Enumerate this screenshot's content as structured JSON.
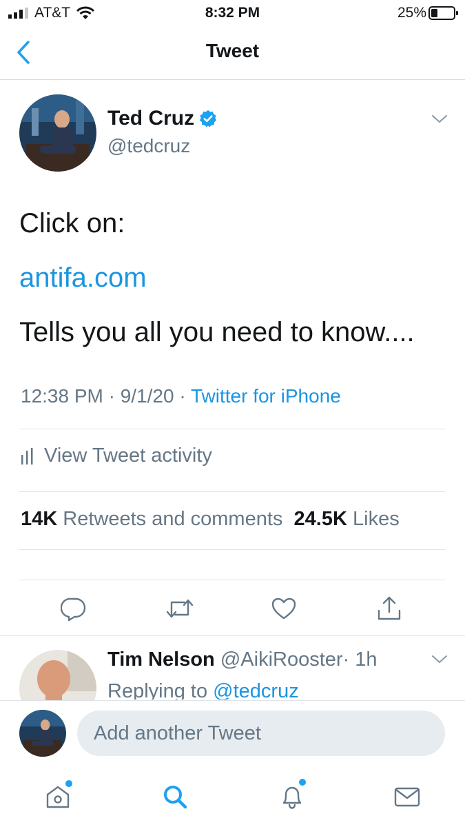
{
  "status_bar": {
    "carrier": "AT&T",
    "time": "8:32 PM",
    "battery": "25%"
  },
  "nav": {
    "title": "Tweet"
  },
  "tweet": {
    "author_name": "Ted Cruz",
    "author_handle": "@tedcruz",
    "text_line1": "Click on:",
    "link": "antifa.com",
    "text_line2": "Tells you all you need to know....",
    "timestamp": "12:38 PM · 9/1/20 · ",
    "source": "Twitter for iPhone",
    "activity_label": "View Tweet activity",
    "retweets_count": "14K",
    "retweets_label": "Retweets and comments",
    "likes_count": "24.5K",
    "likes_label": "Likes"
  },
  "reply": {
    "author_name": "Tim Nelson",
    "author_handle": "@AikiRooster",
    "time_ago": "· 1h",
    "replying_prefix": "Replying to ",
    "replying_handle": "@tedcruz"
  },
  "composer": {
    "placeholder": "Add another Tweet"
  },
  "colors": {
    "accent": "#1da1f2",
    "link": "#1b95e0",
    "secondary_text": "#657786",
    "divider": "#dfe3e6"
  },
  "icons": {
    "back": "chevron-left-icon",
    "caret": "chevron-down-icon",
    "verified": "verified-badge-icon",
    "reply": "reply-icon",
    "retweet": "retweet-icon",
    "like": "heart-icon",
    "share": "share-icon",
    "home": "home-icon",
    "search": "search-icon",
    "notifications": "bell-icon",
    "messages": "envelope-icon"
  }
}
